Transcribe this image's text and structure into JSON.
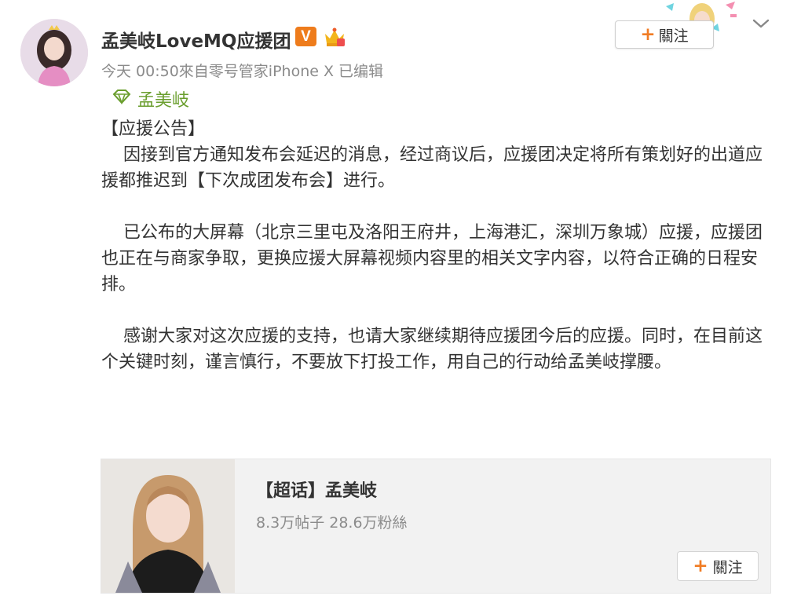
{
  "post": {
    "username": "孟美岐LoveMQ应援团",
    "verified_badge": "V",
    "meta": "今天 00:50來自零号管家iPhone X   已编辑",
    "follow_label": "關注",
    "topic_label": "孟美岐",
    "content": {
      "title": "【应援公告】",
      "p1": "    因接到官方通知发布会延迟的消息，经过商议后，应援团决定将所有策划好的出道应援都推迟到【下次成团发布会】进行。",
      "p2": "    已公布的大屏幕（北京三里屯及洛阳王府井，上海港汇，深圳万象城）应援，应援团也正在与商家争取，更换应援大屏幕视频内容里的相关文字内容，以符合正确的日程安排。",
      "p3": "    感谢大家对这次应援的支持，也请大家继续期待应援团今后的应援。同时，在目前这个关键时刻，谨言慎行，不要放下打投工作，用自己的行动给孟美岐撑腰。"
    }
  },
  "card": {
    "title": "【超话】孟美岐",
    "stats": "8.3万帖子 28.6万粉絲",
    "follow_label": "關注"
  },
  "colors": {
    "accent_orange": "#f07c24",
    "topic_green": "#6a9e2e",
    "meta_gray": "#8b8b8b"
  },
  "icons": [
    "crown-icon",
    "plus-icon",
    "chevron-down-icon",
    "super-topic-diamond-icon"
  ]
}
